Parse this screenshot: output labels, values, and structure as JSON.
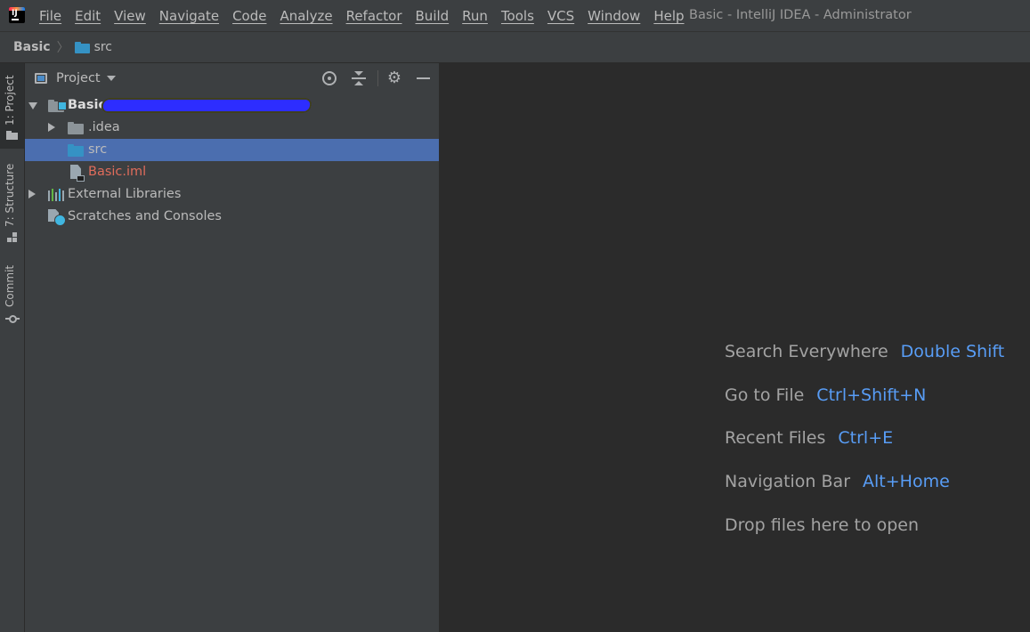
{
  "menu": {
    "items": [
      "File",
      "Edit",
      "View",
      "Navigate",
      "Code",
      "Analyze",
      "Refactor",
      "Build",
      "Run",
      "Tools",
      "VCS",
      "Window",
      "Help"
    ]
  },
  "window_title": "Basic - IntelliJ IDEA - Administrator",
  "breadcrumb": {
    "root": "Basic",
    "child": "src"
  },
  "tool_strip": {
    "project": "1: Project",
    "structure": "7: Structure",
    "commit": "Commit"
  },
  "project_panel": {
    "title": "Project",
    "tree": [
      {
        "label": "Basic",
        "type": "module",
        "expanded": true
      },
      {
        "label": ".idea",
        "type": "folder",
        "expanded": false
      },
      {
        "label": "src",
        "type": "source-folder",
        "selected": true
      },
      {
        "label": "Basic.iml",
        "type": "file"
      },
      {
        "label": "External Libraries",
        "type": "libraries",
        "expanded": false
      },
      {
        "label": "Scratches and Consoles",
        "type": "scratches"
      }
    ]
  },
  "editor": {
    "hints": [
      {
        "action": "Search Everywhere",
        "shortcut": "Double Shift"
      },
      {
        "action": "Go to File",
        "shortcut": "Ctrl+Shift+N"
      },
      {
        "action": "Recent Files",
        "shortcut": "Ctrl+E"
      },
      {
        "action": "Navigation Bar",
        "shortcut": "Alt+Home"
      },
      {
        "action": "Drop files here to open",
        "shortcut": ""
      }
    ]
  },
  "colors": {
    "background": "#3c3f41",
    "editor_background": "#2b2b2b",
    "selection": "#4b6eaf",
    "shortcut_blue": "#589df6",
    "excluded_file_red": "#e06c5b",
    "folder_blue": "#3592c4"
  }
}
